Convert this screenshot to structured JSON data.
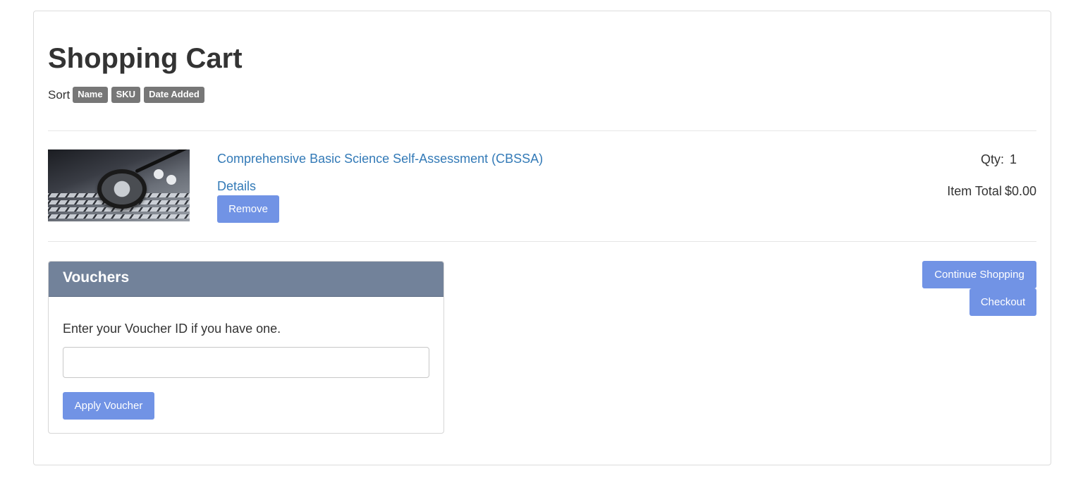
{
  "page": {
    "title": "Shopping Cart"
  },
  "sort": {
    "label": "Sort",
    "options": [
      "Name",
      "SKU",
      "Date Added"
    ]
  },
  "cart_items": [
    {
      "name": "Comprehensive Basic Science Self-Assessment (CBSSA)",
      "details_label": "Details",
      "remove_label": "Remove",
      "qty_label": "Qty:",
      "qty": "1",
      "total_label": "Item Total",
      "total": "$0.00",
      "image": "stethoscope-on-laptop-keyboard"
    }
  ],
  "vouchers": {
    "heading": "Vouchers",
    "help_text": "Enter your Voucher ID if you have one.",
    "input_value": "",
    "input_placeholder": "",
    "apply_label": "Apply Voucher"
  },
  "actions": {
    "continue_label": "Continue Shopping",
    "checkout_label": "Checkout"
  },
  "colors": {
    "button": "#7193e5",
    "link": "#337ab7",
    "badge": "#777777",
    "panel_header": "#72829a"
  }
}
